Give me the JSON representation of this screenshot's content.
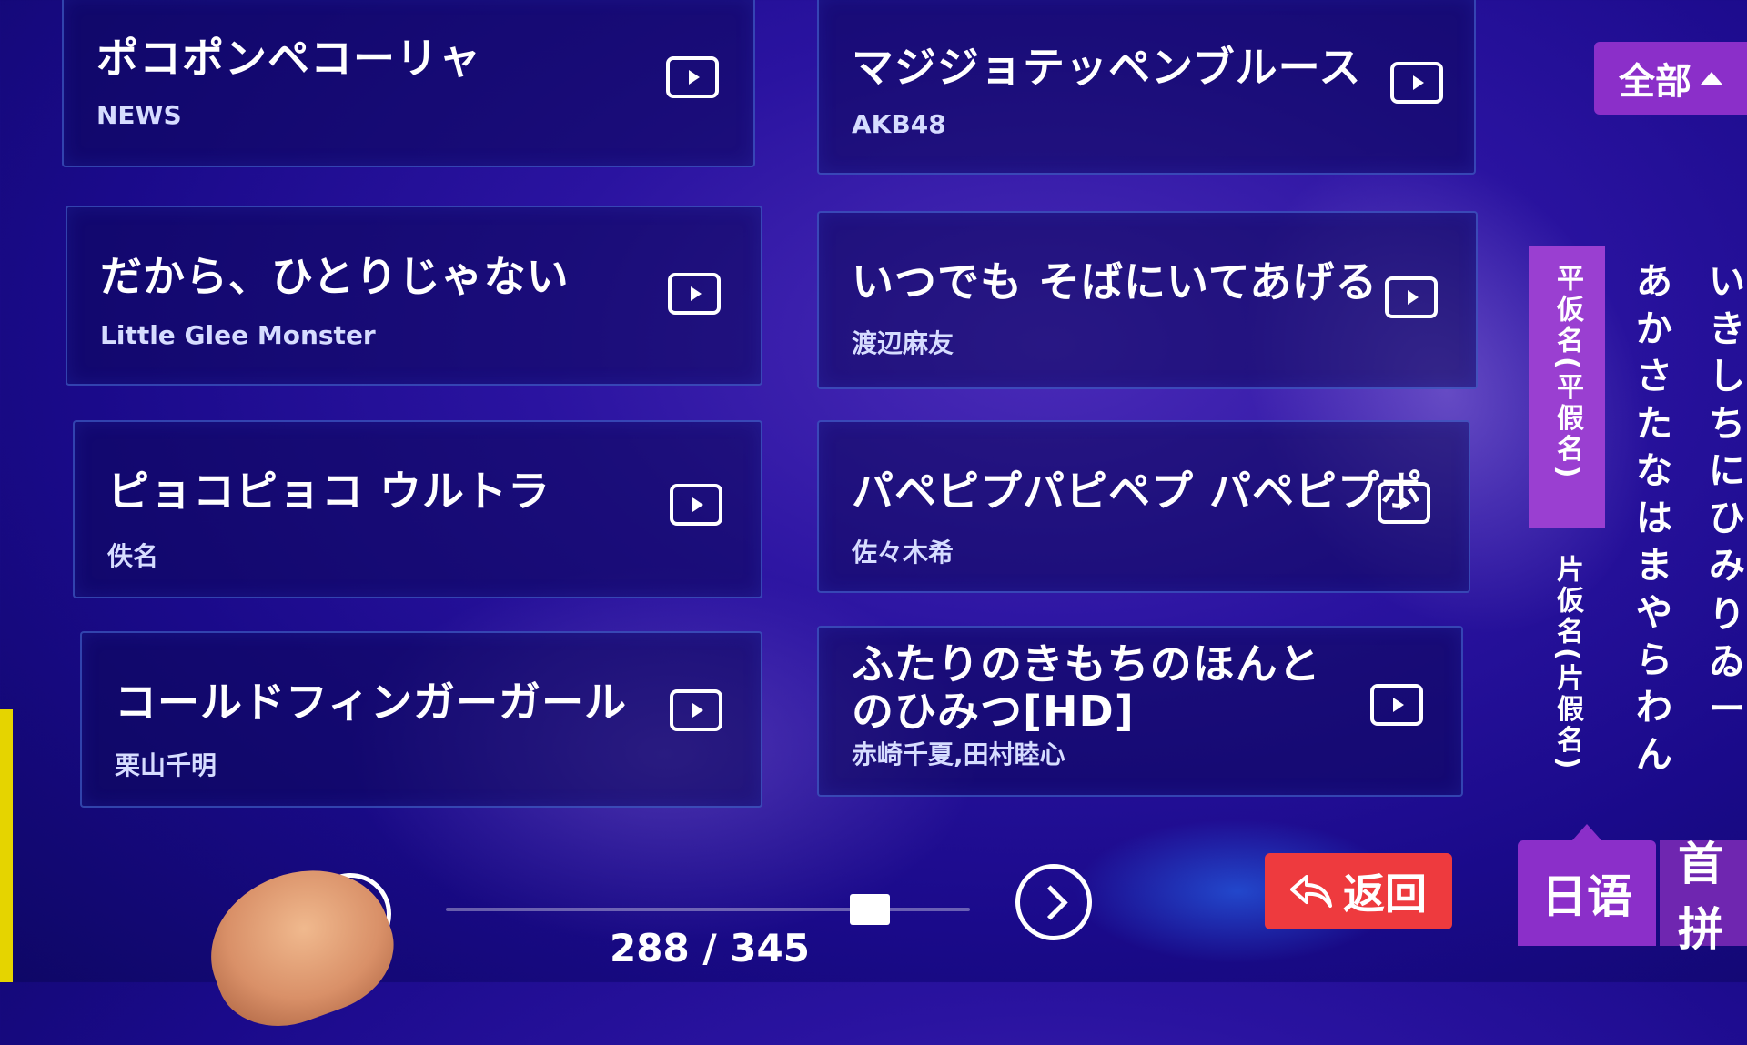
{
  "songs": [
    {
      "title": "ポコポンペコーリャ",
      "artist": "NEWS"
    },
    {
      "title": "マジジョテッペンブルース",
      "artist": "AKB48"
    },
    {
      "title": "だから、ひとりじゃない",
      "artist": "Little Glee Monster"
    },
    {
      "title": "いつでも そばにいてあげる",
      "artist": "渡辺麻友"
    },
    {
      "title": "ピョコピョコ ウルトラ",
      "artist": "佚名"
    },
    {
      "title": "パペピプパピペプ パペピプポ",
      "artist": "佐々木希"
    },
    {
      "title": "コールドフィンガーガール",
      "artist": "栗山千明"
    },
    {
      "title": "ふたりのきもちのほんとのひみつ[HD]",
      "artist": "赤崎千夏,田村睦心"
    }
  ],
  "filter": {
    "all_label": "全部"
  },
  "kana": {
    "hiragana_tab": "平仮名(平假名)",
    "katakana_tab": "片仮名(片假名)",
    "column_a": [
      "あ",
      "か",
      "さ",
      "た",
      "な",
      "は",
      "ま",
      "や",
      "ら",
      "わ",
      "ん"
    ],
    "column_i": [
      "い",
      "き",
      "し",
      "ち",
      "に",
      "ひ",
      "み",
      "",
      "り",
      "ゐ",
      "ー"
    ]
  },
  "language_tabs": {
    "active": "日语",
    "next": "首拼"
  },
  "back_label": "返回",
  "pagination": {
    "current": 288,
    "total": 345,
    "text": "288 / 345",
    "progress": 0.834
  },
  "icons": {
    "play": "play-video-icon",
    "back": "back-arrow-icon",
    "next": "chevron-right-icon",
    "caret": "caret-up-icon"
  },
  "colors": {
    "accent_purple": "#8b2fc9",
    "back_red": "#ee3a3e"
  }
}
